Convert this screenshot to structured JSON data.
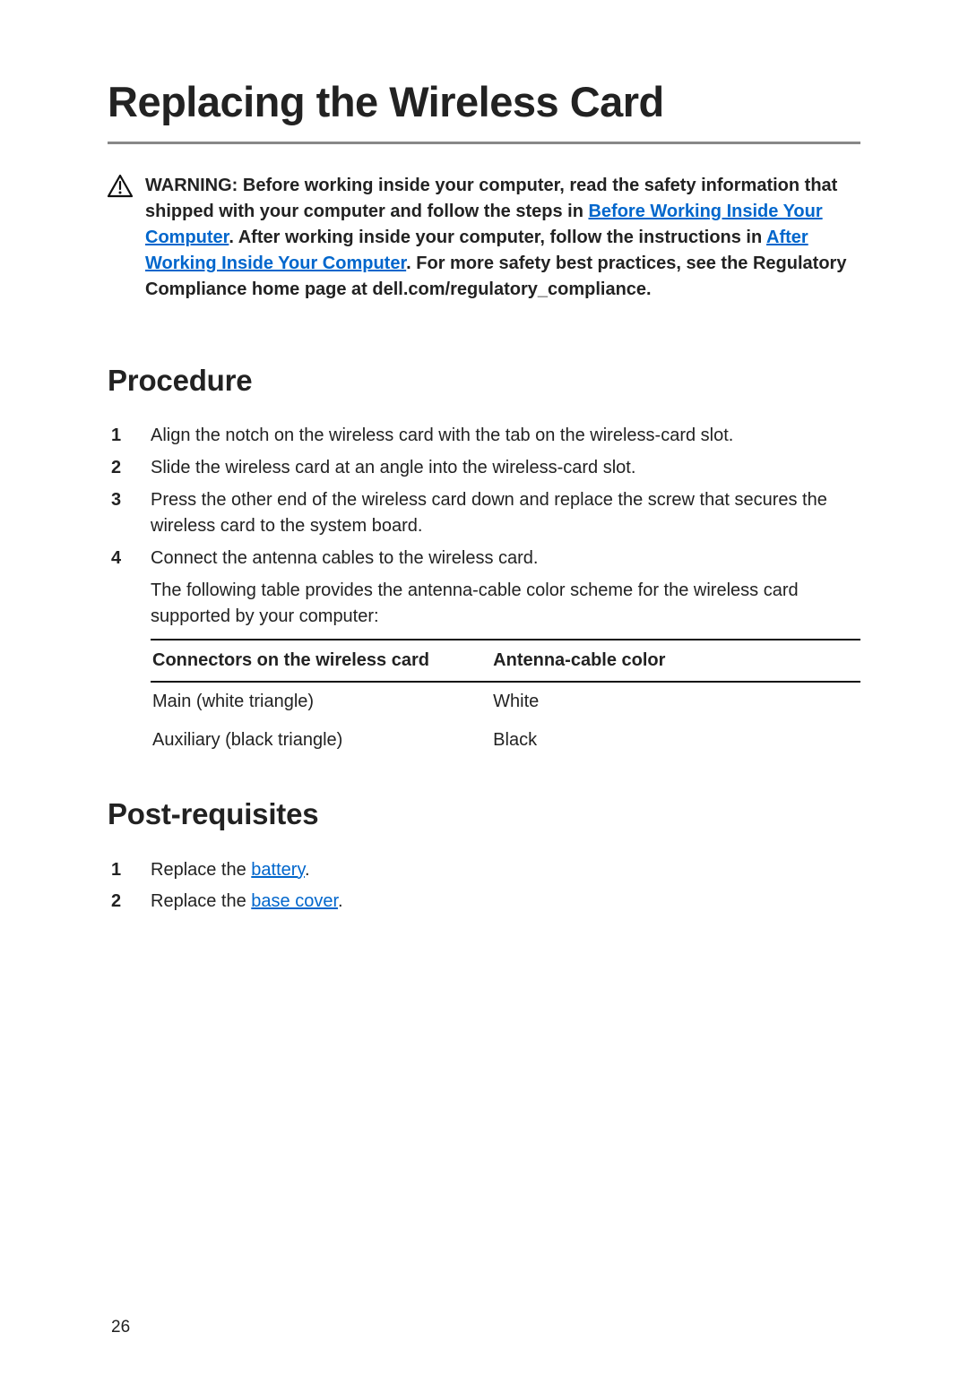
{
  "title": "Replacing the Wireless Card",
  "warning": {
    "text1": "WARNING: Before working inside your computer, read the safety information that shipped with your computer and follow the steps in ",
    "link1": "Before Working Inside Your Computer",
    "text2": ". After working inside your computer, follow the instructions in ",
    "link2": "After Working Inside Your Computer",
    "text3": ". For more safety best practices, see the Regulatory Compliance home page at dell.com/regulatory_compliance."
  },
  "sections": {
    "procedure_heading": "Procedure",
    "postreq_heading": "Post-requisites"
  },
  "procedure": {
    "steps": [
      "Align the notch on the wireless card with the tab on the wireless-card slot.",
      "Slide the wireless card at an angle into the wireless-card slot.",
      "Press the other end of the wireless card down and replace the screw that secures the wireless card to the system board.",
      "Connect the antenna cables to the wireless card."
    ],
    "step4_note": "The following table provides the antenna-cable color scheme for the wireless card supported by your computer:"
  },
  "table": {
    "headers": {
      "col1": "Connectors on the wireless card",
      "col2": "Antenna-cable color"
    },
    "rows": [
      {
        "col1": "Main (white triangle)",
        "col2": "White"
      },
      {
        "col1": "Auxiliary (black triangle)",
        "col2": "Black"
      }
    ]
  },
  "postreq": {
    "steps": [
      {
        "prefix": "Replace the ",
        "link": "battery",
        "suffix": "."
      },
      {
        "prefix": "Replace the ",
        "link": "base cover",
        "suffix": "."
      }
    ]
  },
  "page_number": "26"
}
